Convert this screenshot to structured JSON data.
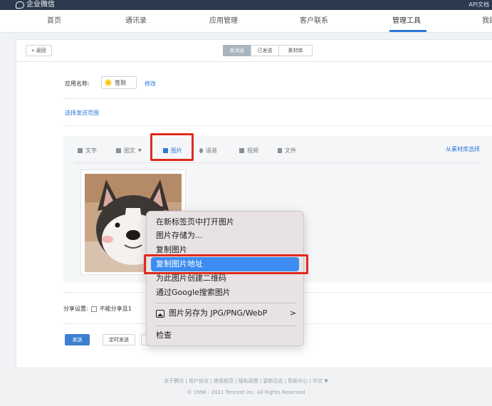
{
  "topbar": {
    "brand": "企业微信",
    "api_docs": "API文档"
  },
  "nav": {
    "items": [
      "首页",
      "通讯录",
      "应用管理",
      "客户联系",
      "管理工具",
      "我的"
    ],
    "active": "管理工具"
  },
  "panel": {
    "back": "« 返回",
    "segments": [
      "发消息",
      "已发送",
      "素材库"
    ],
    "active_segment": "发消息",
    "app_label": "应用名称:",
    "app_name": "签到",
    "edit_link": "修改",
    "scope_link": "选择发送范围"
  },
  "toolbar": {
    "tools": [
      {
        "label": "文字",
        "icon": "text-icon"
      },
      {
        "label": "图文",
        "icon": "article-icon",
        "dropdown": "▼"
      },
      {
        "label": "图片",
        "icon": "image-icon"
      },
      {
        "label": "语音",
        "icon": "voice-icon"
      },
      {
        "label": "视频",
        "icon": "video-icon"
      },
      {
        "label": "文件",
        "icon": "file-icon"
      }
    ],
    "active": "图片",
    "from_library": "从素材库选择"
  },
  "share": {
    "label": "分享设置:",
    "checkbox_label": "不能分享且1"
  },
  "buttons": {
    "send": "发送",
    "timed_send": "定时发送"
  },
  "context_menu": {
    "items": [
      "在新标签页中打开图片",
      "图片存储为...",
      "复制图片",
      "复制图片地址",
      "为此图片创建二维码",
      "通过Google搜索图片",
      "图片另存为 JPG/PNG/WebP",
      "检查"
    ],
    "selected": "复制图片地址",
    "submenu_arrow": ">"
  },
  "footer": {
    "links": "关于腾讯 | 用户协议 | 使用规范 | 隐私政策 | 更新日志 | 帮助中心 | 中文 ▼",
    "copyright": "© 1998 - 2021 Tencent Inc. All Rights Reserved"
  },
  "colors": {
    "accent": "#2c79d6",
    "highlight": "#e02a1f",
    "menu_selected": "#3d8cf0",
    "topbar": "#2b3a4e"
  }
}
